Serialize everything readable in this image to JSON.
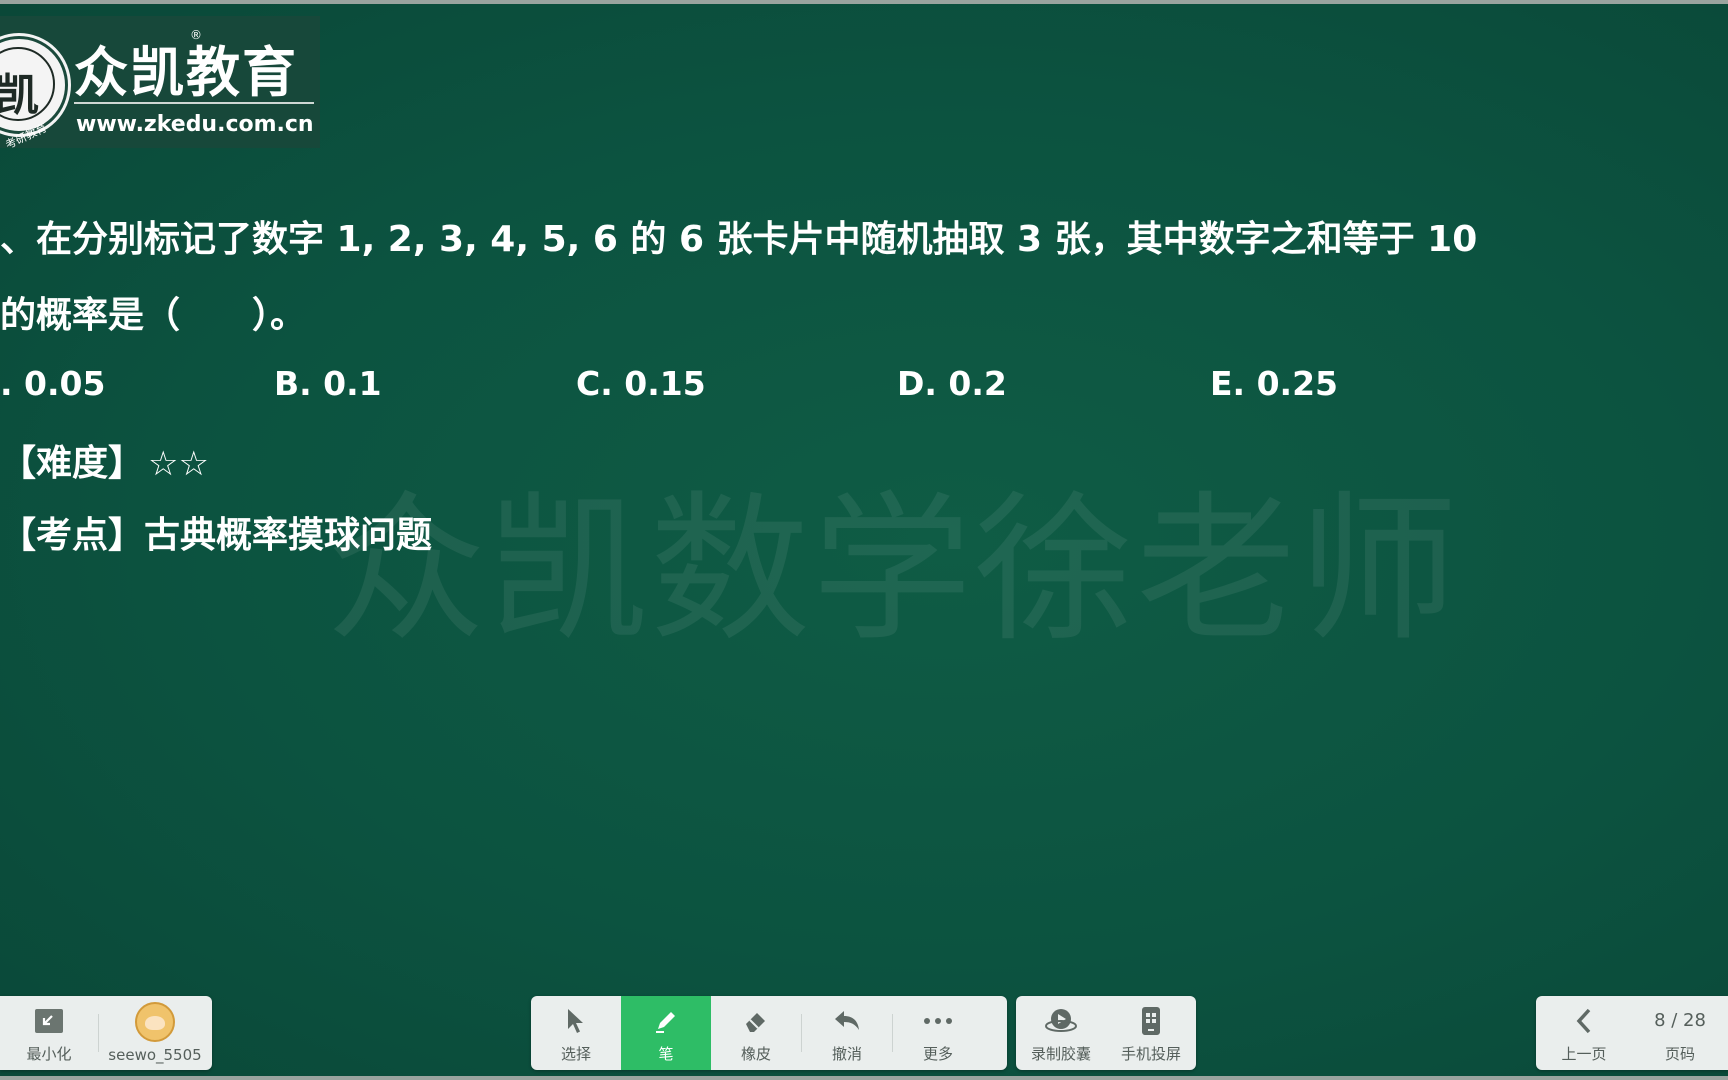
{
  "logo": {
    "brand_name": "众凯教育",
    "registered_mark": "®",
    "url": "www.zkedu.com.cn",
    "seal_char": "凯",
    "seal_text": "考研教育"
  },
  "watermark": "众凯数学徐老师",
  "question": {
    "line1": "、在分别标记了数字 1, 2, 3, 4, 5, 6 的 6 张卡片中随机抽取 3 张，其中数字之和等于 10",
    "line2": "的概率是（　　）。",
    "options": [
      ". 0.05",
      "B. 0.1",
      "C. 0.15",
      "D. 0.2",
      "E. 0.25"
    ]
  },
  "meta": {
    "difficulty_label": "【难度】",
    "difficulty_stars": "☆☆",
    "topic": "【考点】古典概率摸球问题"
  },
  "toolbar_left": {
    "minimize_label": "最小化",
    "user_label": "seewo_5505"
  },
  "toolbar_center": {
    "items": [
      {
        "label": "选择",
        "icon": "cursor-icon"
      },
      {
        "label": "笔",
        "icon": "pen-icon"
      },
      {
        "label": "橡皮",
        "icon": "eraser-icon"
      },
      {
        "label": "撤消",
        "icon": "undo-icon"
      },
      {
        "label": "更多",
        "icon": "more-icon"
      }
    ]
  },
  "toolbar_right": {
    "items": [
      {
        "label": "录制胶囊",
        "icon": "record-capsule-icon"
      },
      {
        "label": "手机投屏",
        "icon": "phone-cast-icon"
      }
    ]
  },
  "nav": {
    "prev_label": "上一页",
    "page_label": "页码",
    "page_indicator": "8 / 28"
  },
  "colors": {
    "board": "#0c5340",
    "active_tool": "#2ebd66",
    "toolbar_bg": "#eaeeed"
  }
}
